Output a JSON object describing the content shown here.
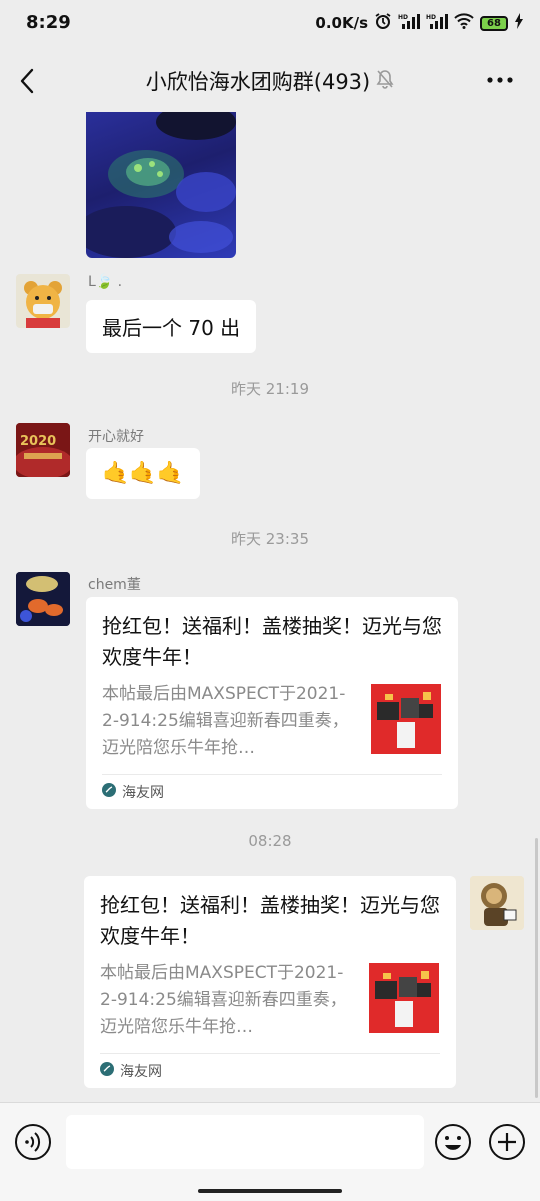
{
  "status_bar": {
    "time": "8:29",
    "net_speed": "0.0K/s",
    "battery": "68",
    "icons": [
      "alarm-icon",
      "signal-hd-icon",
      "signal-hd-icon",
      "wifi-icon",
      "battery-icon",
      "charging-icon"
    ]
  },
  "header": {
    "title": "小欣怡海水团购群(493)",
    "icons": [
      "back-icon",
      "mute-bell-icon",
      "more-icon"
    ]
  },
  "messages": {
    "m1": {
      "sender": "L🍃 .",
      "text": "最后一个 70 出"
    },
    "t1": "昨天 21:19",
    "m2": {
      "sender": "开心就好",
      "text": "🤙🤙🤙",
      "avatar_text": "2020"
    },
    "t2": "昨天 23:35",
    "m3": {
      "sender": "chem董",
      "title": "抢红包！送福利！盖楼抽奖！迈光与您欢度牛年！",
      "desc": "本帖最后由MAXSPECT于2021-2-914:25编辑喜迎新春四重奏，迈光陪您乐牛年抢…",
      "site": "海友网"
    },
    "t3": "08:28",
    "m4": {
      "title": "抢红包！送福利！盖楼抽奖！迈光与您欢度牛年！",
      "desc": "本帖最后由MAXSPECT于2021-2-914:25编辑喜迎新春四重奏，迈光陪您乐牛年抢…",
      "site": "海友网"
    }
  },
  "input_bar": {
    "placeholder": "",
    "icons": [
      "voice-icon",
      "emoji-icon",
      "plus-icon"
    ]
  },
  "colors": {
    "background": "#EDEDED",
    "bubble": "#FFFFFF",
    "red_envelope": "#E02A2A"
  }
}
